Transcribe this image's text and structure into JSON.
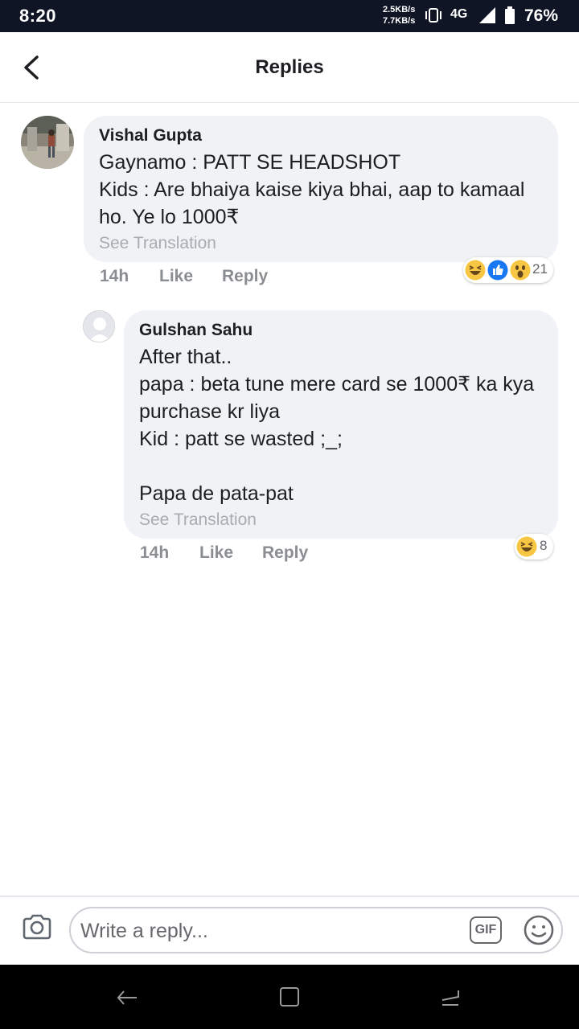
{
  "status_bar": {
    "time": "8:20",
    "speed_up": "2.5KB/s",
    "speed_down": "7.7KB/s",
    "network": "4G",
    "battery": "76%"
  },
  "header": {
    "title": "Replies"
  },
  "comments": [
    {
      "author": "Vishal Gupta",
      "text": "Gaynamo : PATT SE HEADSHOT\nKids : Are bhaiya kaise kiya bhai, aap to kamaal ho. Ye lo 1000₹",
      "translation_label": "See Translation",
      "time": "14h",
      "like_label": "Like",
      "reply_label": "Reply",
      "reactions": [
        "laughing-emoji",
        "like-emoji",
        "wow-emoji"
      ],
      "reaction_count": "21"
    },
    {
      "author": "Gulshan Sahu",
      "text": "After that..\npapa : beta tune mere card se 1000₹ ka kya purchase kr liya\nKid : patt se wasted ;_;\n\nPapa de pata-pat",
      "translation_label": "See Translation",
      "time": "14h",
      "like_label": "Like",
      "reply_label": "Reply",
      "reactions": [
        "laughing-emoji"
      ],
      "reaction_count": "8"
    }
  ],
  "composer": {
    "placeholder": "Write a reply...",
    "gif_label": "GIF"
  },
  "colors": {
    "status_bar_bg": "#0f1525",
    "bubble_bg": "#f0f2f5",
    "like_blue": "#1877f2",
    "emoji_yellow": "#f7c744"
  }
}
